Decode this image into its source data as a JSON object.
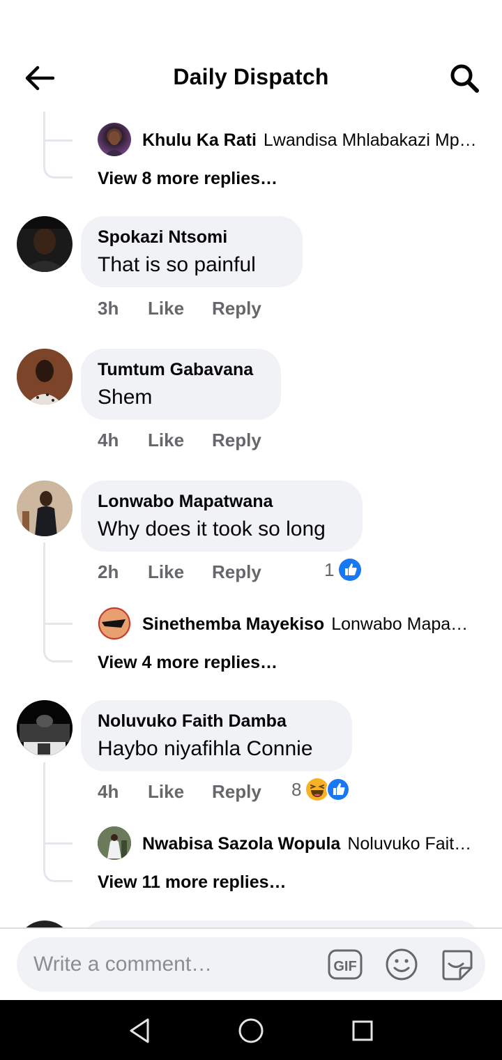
{
  "header": {
    "title": "Daily Dispatch"
  },
  "feed": {
    "top_reply": {
      "author": "Khulu Ka Rati",
      "text": "Lwandisa Mhlabakazi Mp…",
      "view_more": "View 8 more replies…"
    },
    "comments": [
      {
        "author": "Spokazi Ntsomi",
        "text": "That is so  painful",
        "time": "3h",
        "like": "Like",
        "reply": "Reply"
      },
      {
        "author": "Tumtum Gabavana",
        "text": "Shem",
        "time": "4h",
        "like": "Like",
        "reply": "Reply"
      },
      {
        "author": "Lonwabo Mapatwana",
        "text": "Why does it took so long",
        "time": "2h",
        "like": "Like",
        "reply": "Reply",
        "reaction_count": "1",
        "reply_preview": {
          "author": "Sinethemba Mayekiso",
          "text": "Lonwabo Mapa…"
        },
        "view_more": "View 4 more replies…"
      },
      {
        "author": "Noluvuko Faith Damba",
        "text": "Haybo niyafihla Connie",
        "time": "4h",
        "like": "Like",
        "reply": "Reply",
        "reaction_count": "8",
        "reply_preview": {
          "author": "Nwabisa Sazola Wopula",
          "text": "Noluvuko Fait…"
        },
        "view_more": "View 11 more replies…"
      }
    ]
  },
  "composer": {
    "placeholder": "Write a comment…",
    "gif_label": "GIF"
  },
  "colors": {
    "like_blue": "#1877f2",
    "haha_yellow": "#f7b125",
    "bubble_bg": "#f0f2f5",
    "meta_grey": "#65676b"
  }
}
